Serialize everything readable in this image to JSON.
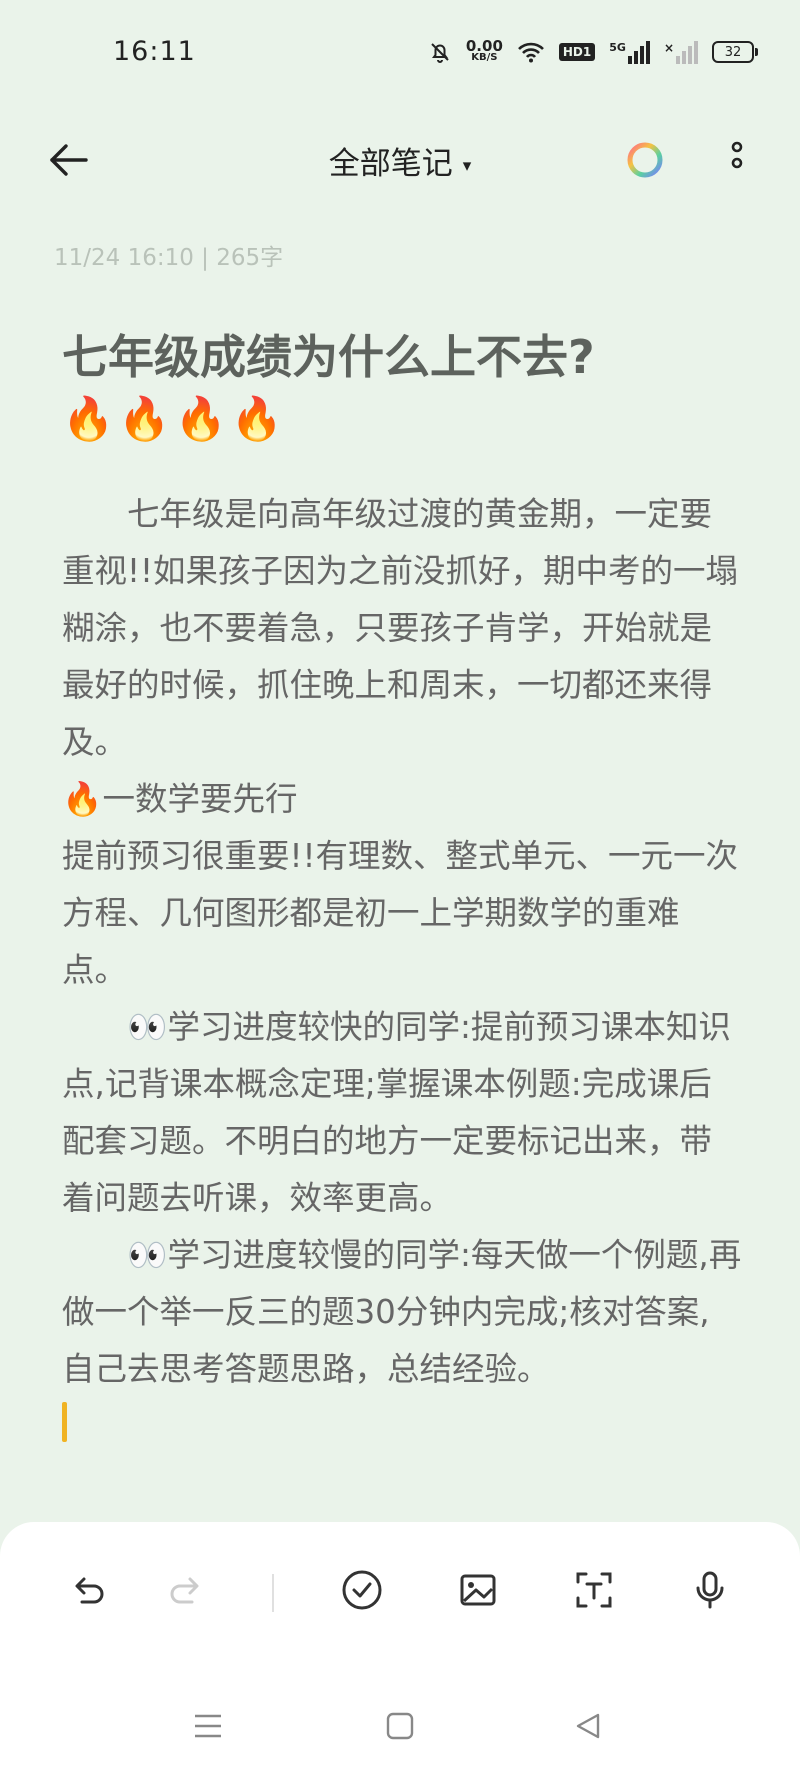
{
  "status_bar": {
    "time": "16:11",
    "net_speed_value": "0.00",
    "net_speed_unit": "KB/S",
    "hd_label": "HD1",
    "signal_label": "5G",
    "battery_level": "32"
  },
  "app_bar": {
    "title": "全部笔记",
    "caret": "▾"
  },
  "note": {
    "meta": "11/24 16:10 | 265字",
    "title": "七年级成绩为什么上不去?",
    "title_emojis": "🔥🔥🔥🔥",
    "paragraphs": [
      "七年级是向高年级过渡的黄金期，一定要重视!!如果孩子因为之前没抓好，期中考的一塌糊涂，也不要着急，只要孩子肯学，开始就是最好的时候，抓住晚上和周末，一切都还来得及。",
      "🔥一数学要先行",
      "提前预习很重要!!有理数、整式单元、一元一次方程、几何图形都是初一上学期数学的重难点。",
      "👀学习进度较快的同学:提前预习课本知识点,记背课本概念定理;掌握课本例题:完成课后配套习题。不明白的地方一定要标记出来，带着问题去听课，效率更高。",
      "👀学习进度较慢的同学:每天做一个例题,再做一个举一反三的题30分钟内完成;核对答案,自己去思考答题思路，总结经验。"
    ]
  },
  "colors": {
    "background": "#eaf3ea",
    "cursor": "#f0b323",
    "toolbar": "#ffffff"
  }
}
